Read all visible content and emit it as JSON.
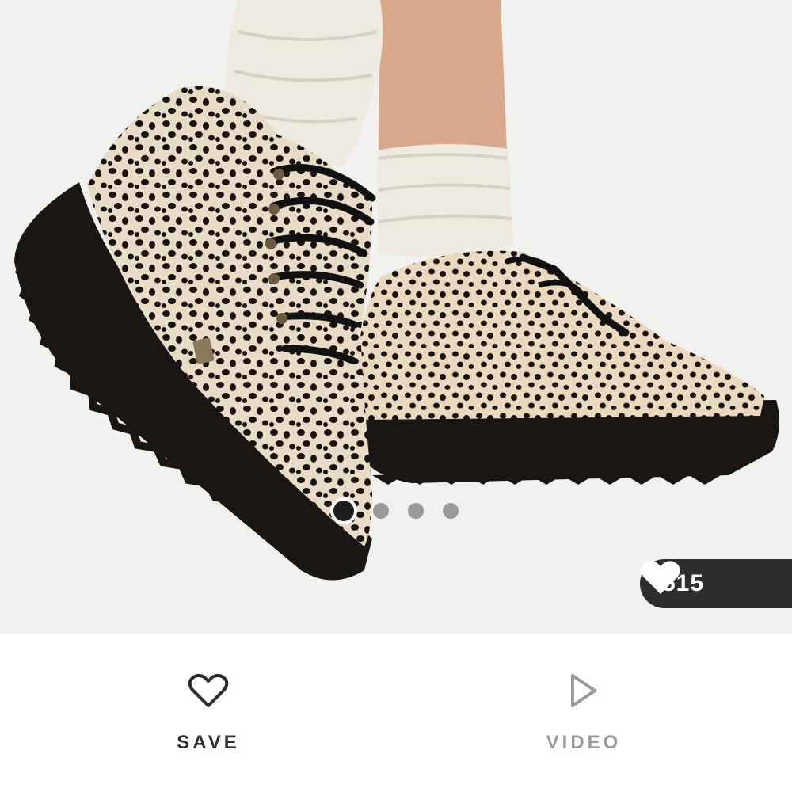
{
  "product_image": {
    "alt_icon": "product-photo",
    "background_color": "#f1f1ef"
  },
  "carousel": {
    "total": 4,
    "active_index": 0
  },
  "likes": {
    "count": "515",
    "icon": "heart-icon"
  },
  "actions": {
    "save_label": "SAVE",
    "save_icon": "heart-outline-icon",
    "video_label": "VIDEO",
    "video_icon": "play-icon"
  },
  "colors": {
    "dark": "#2d2d2d",
    "muted": "#999999"
  }
}
